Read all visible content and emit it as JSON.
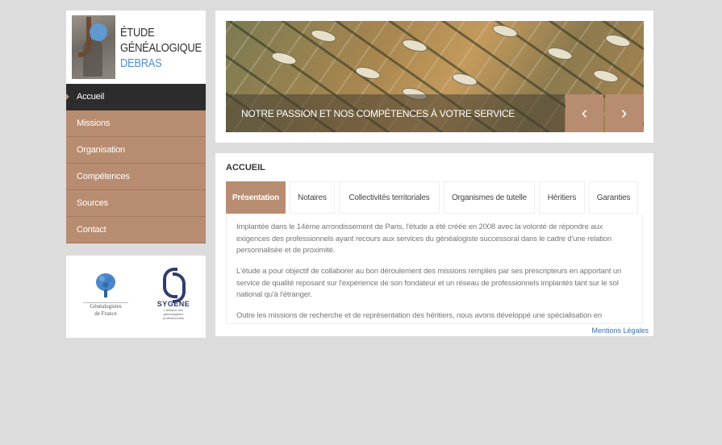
{
  "logo": {
    "line1": "ÉTUDE",
    "line2": "GÉNÉALOGIQUE",
    "line3": "DEBRAS"
  },
  "nav": {
    "items": [
      {
        "label": "Accueil",
        "active": true
      },
      {
        "label": "Missions"
      },
      {
        "label": "Organisation"
      },
      {
        "label": "Compétences"
      },
      {
        "label": "Sources"
      },
      {
        "label": "Contact"
      }
    ]
  },
  "partners": {
    "gdf": {
      "line1": "Généalogistes",
      "line2": "de France"
    },
    "sygene": {
      "name": "SYGENE",
      "tagline_1": "L'alliance des",
      "tagline_2": "généalogistes",
      "tagline_3": "professionnels"
    }
  },
  "banner": {
    "caption": "NOTRE PASSION ET NOS COMPÉTENCES À VOTRE SERVICE",
    "prev_icon": "chevron-left-icon",
    "next_icon": "chevron-right-icon"
  },
  "content": {
    "title": "ACCUEIL",
    "tabs": [
      {
        "label": "Présentation",
        "active": true
      },
      {
        "label": "Notaires"
      },
      {
        "label": "Collectivités territoriales"
      },
      {
        "label": "Organismes de tutelle"
      },
      {
        "label": "Héritiers"
      },
      {
        "label": "Garanties"
      }
    ],
    "paragraphs": [
      "Implantée dans le 14ème arrondissement de Paris, l'étude a été créée en 2008 avec la volonté de répondre aux exigences des professionnels ayant recours aux services du généalogiste successoral dans le cadre d'une relation personnalisée et de proximité.",
      "L'étude a pour objectif de collaborer au bon déroulement des missions remplies par ses prescripteurs en apportant un service de qualité reposant sur l'expérience de son fondateur et un réseau de professionnels implantés tant sur le sol national qu'à l'étranger.",
      "Outre les missions de recherche et de représentation des héritiers, nous avons développé une spécialisation en"
    ]
  },
  "footer": {
    "legal_link": "Mentions Légales"
  },
  "colors": {
    "page_bg": "#dcdcdc",
    "accent": "#b88c70",
    "nav_active": "#2c2c2c",
    "link": "#3d6fa8"
  }
}
